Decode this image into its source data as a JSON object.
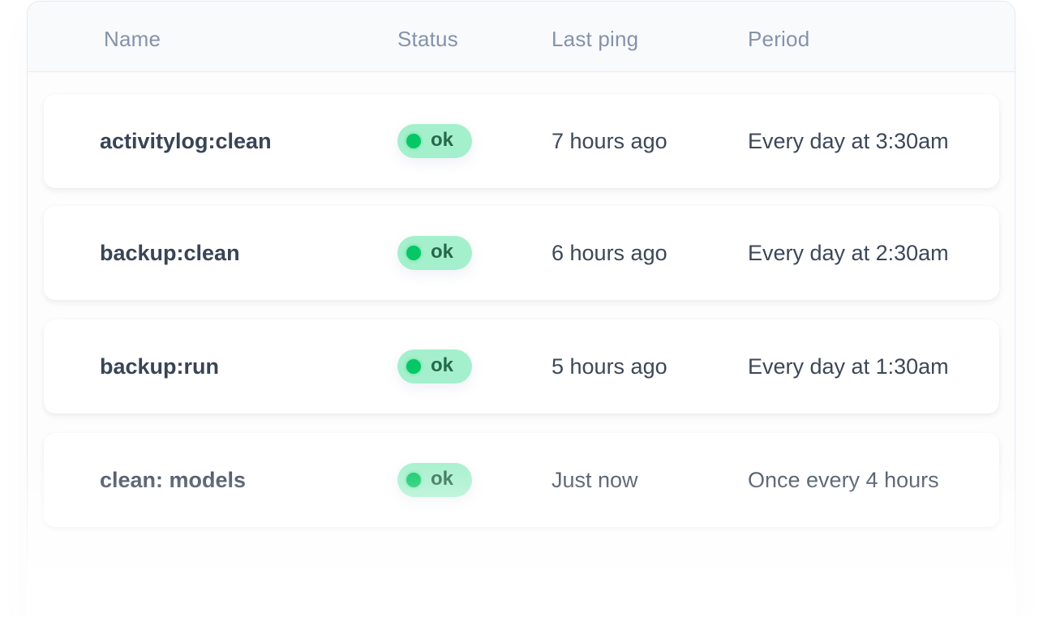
{
  "table": {
    "columns": {
      "name": "Name",
      "status": "Status",
      "last_ping": "Last ping",
      "period": "Period"
    },
    "status_colors": {
      "badge_bg": "#a4f0cc",
      "dot": "#06c765",
      "text": "#27684a"
    },
    "rows": [
      {
        "name": "activitylog:clean",
        "status": "ok",
        "last_ping": "7 hours ago",
        "period": "Every day at 3:30am"
      },
      {
        "name": "backup:clean",
        "status": "ok",
        "last_ping": "6 hours ago",
        "period": "Every day at 2:30am"
      },
      {
        "name": "backup:run",
        "status": "ok",
        "last_ping": "5 hours ago",
        "period": "Every day at 1:30am"
      },
      {
        "name": "clean: models",
        "status": "ok",
        "last_ping": "Just now",
        "period": "Once every 4 hours"
      }
    ]
  }
}
